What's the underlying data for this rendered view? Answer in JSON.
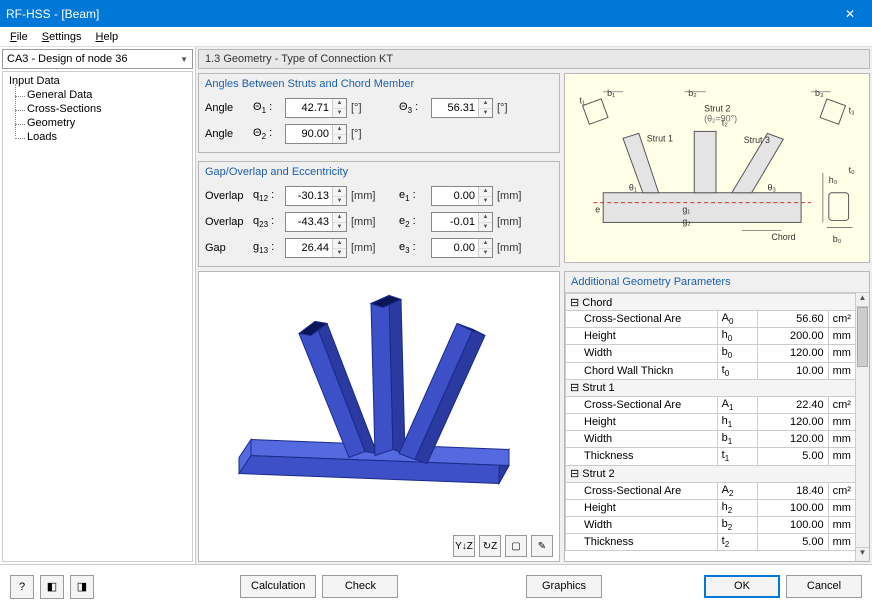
{
  "window": {
    "title": "RF-HSS - [Beam]"
  },
  "menu": {
    "file": "File",
    "settings": "Settings",
    "help": "Help"
  },
  "dropdown": {
    "selected": "CA3 - Design of node 36"
  },
  "tree": {
    "root": "Input Data",
    "items": [
      "General Data",
      "Cross-Sections",
      "Geometry",
      "Loads"
    ],
    "selected": 2
  },
  "header": "1.3 Geometry - Type of Connection KT",
  "angles": {
    "title": "Angles Between Struts and Chord Member",
    "rows": [
      {
        "label": "Angle",
        "sym": "Θ",
        "sub": "1",
        "val": "42.71",
        "unit": "[°]",
        "sym2": "Θ",
        "sub2": "3",
        "val2": "56.31",
        "unit2": "[°]"
      },
      {
        "label": "Angle",
        "sym": "Θ",
        "sub": "2",
        "val": "90.00",
        "unit": "[°]"
      }
    ]
  },
  "gap": {
    "title": "Gap/Overlap and Eccentricity",
    "rows": [
      {
        "label": "Overlap",
        "sym": "q",
        "sub": "12",
        "val": "-30.13",
        "unit": "[mm]",
        "sym2": "e",
        "sub2": "1",
        "val2": "0.00",
        "unit2": "[mm]"
      },
      {
        "label": "Overlap",
        "sym": "q",
        "sub": "23",
        "val": "-43.43",
        "unit": "[mm]",
        "sym2": "e",
        "sub2": "2",
        "val2": "-0.01",
        "unit2": "[mm]"
      },
      {
        "label": "Gap",
        "sym": "g",
        "sub": "13",
        "val": "26.44",
        "unit": "[mm]",
        "sym2": "e",
        "sub2": "3",
        "val2": "0.00",
        "unit2": "[mm]"
      }
    ]
  },
  "diagram": {
    "labels": {
      "strut1": "Strut 1",
      "strut2": "Strut 2",
      "strut2_note": "(θ₂=90°)",
      "strut3": "Strut 3",
      "chord": "Chord",
      "t1": "t₁",
      "b1": "b₁",
      "t2": "t₂",
      "b2": "b₂",
      "t3": "t₃",
      "b3": "b₃",
      "t0": "t₀",
      "h0": "h₀",
      "b0": "b₀",
      "e": "e",
      "g1": "g₁",
      "g2": "g₂",
      "th1": "θ₁",
      "th3": "θ₃"
    }
  },
  "params": {
    "title": "Additional Geometry Parameters",
    "sections": [
      {
        "name": "Chord",
        "rows": [
          {
            "name": "Cross-Sectional Are",
            "sym": "A",
            "sub": "0",
            "val": "56.60",
            "unit": "cm²"
          },
          {
            "name": "Height",
            "sym": "h",
            "sub": "0",
            "val": "200.00",
            "unit": "mm"
          },
          {
            "name": "Width",
            "sym": "b",
            "sub": "0",
            "val": "120.00",
            "unit": "mm"
          },
          {
            "name": "Chord Wall Thickn",
            "sym": "t",
            "sub": "0",
            "val": "10.00",
            "unit": "mm"
          }
        ]
      },
      {
        "name": "Strut 1",
        "rows": [
          {
            "name": "Cross-Sectional Are",
            "sym": "A",
            "sub": "1",
            "val": "22.40",
            "unit": "cm²"
          },
          {
            "name": "Height",
            "sym": "h",
            "sub": "1",
            "val": "120.00",
            "unit": "mm"
          },
          {
            "name": "Width",
            "sym": "b",
            "sub": "1",
            "val": "120.00",
            "unit": "mm"
          },
          {
            "name": "Thickness",
            "sym": "t",
            "sub": "1",
            "val": "5.00",
            "unit": "mm"
          }
        ]
      },
      {
        "name": "Strut 2",
        "rows": [
          {
            "name": "Cross-Sectional Are",
            "sym": "A",
            "sub": "2",
            "val": "18.40",
            "unit": "cm²"
          },
          {
            "name": "Height",
            "sym": "h",
            "sub": "2",
            "val": "100.00",
            "unit": "mm"
          },
          {
            "name": "Width",
            "sym": "b",
            "sub": "2",
            "val": "100.00",
            "unit": "mm"
          },
          {
            "name": "Thickness",
            "sym": "t",
            "sub": "2",
            "val": "5.00",
            "unit": "mm"
          }
        ]
      }
    ]
  },
  "buttons": {
    "calculation": "Calculation",
    "check": "Check",
    "graphics": "Graphics",
    "ok": "OK",
    "cancel": "Cancel"
  },
  "toolbar": {
    "yz": "Y↓Z",
    "rot": "↻Z",
    "cube": "▢",
    "pick": "✎"
  }
}
